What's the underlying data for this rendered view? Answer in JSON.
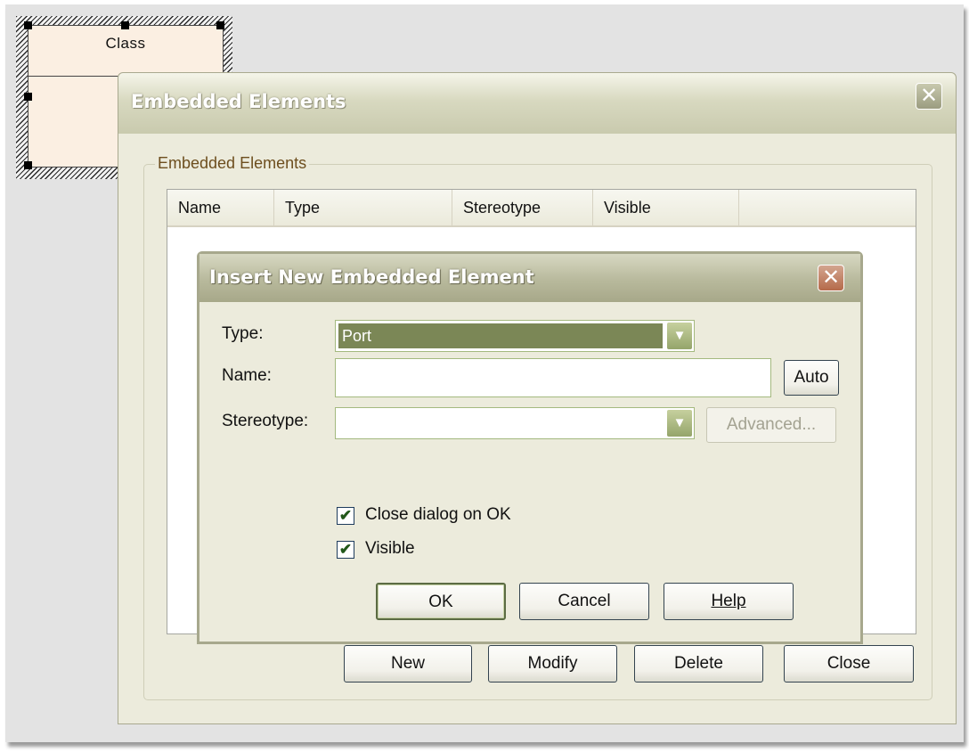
{
  "diagram": {
    "class_name": "Class"
  },
  "embedded_dialog": {
    "title": "Embedded Elements",
    "close_glyph": "✕",
    "group_label": "Embedded Elements",
    "columns": [
      "Name",
      "Type",
      "Stereotype",
      "Visible"
    ],
    "buttons": {
      "new": "New",
      "modify": "Modify",
      "delete": "Delete",
      "close": "Close"
    }
  },
  "insert_dialog": {
    "title": "Insert New Embedded Element",
    "close_glyph": "✕",
    "type_label": "Type:",
    "type_value": "Port",
    "name_label": "Name:",
    "name_value": "",
    "auto_button": "Auto",
    "stereotype_label": "Stereotype:",
    "stereotype_value": "",
    "advanced_button": "Advanced...",
    "close_on_ok_label": "Close dialog on OK",
    "close_on_ok_checked": true,
    "visible_label": "Visible",
    "visible_checked": true,
    "ok_button": "OK",
    "cancel_button": "Cancel",
    "help_button": "Help",
    "check_glyph": "✔",
    "dropdown_glyph": "▼"
  },
  "colors": {
    "title_accent": "#c9caae",
    "selection": "#7b8756",
    "close_button_active": "#b56a4a"
  }
}
